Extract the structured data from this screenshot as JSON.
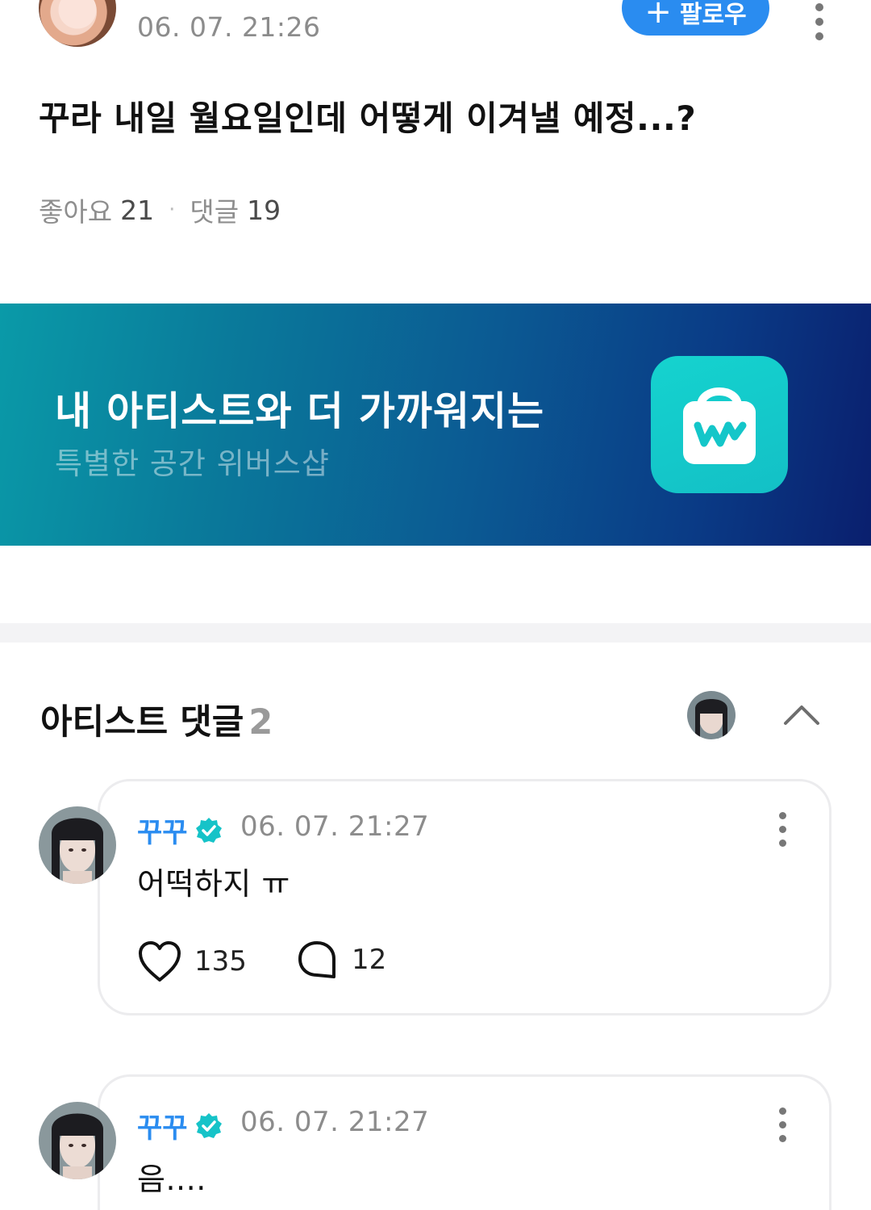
{
  "post": {
    "time": "06. 07. 21:26",
    "follow_label": "팔로우",
    "follow_plus": "+",
    "body": "꾸라 내일 월요일인데 어떻게 이겨낼 예정...?",
    "likes_label": "좋아요",
    "likes_count": "21",
    "comments_label": "댓글",
    "comments_count": "19",
    "separator": "·"
  },
  "banner": {
    "title": "내 아티스트와 더 가까워지는",
    "subtitle": "특별한 공간 위버스샵",
    "icon": "weverse-shop-bag-icon"
  },
  "artist_comments": {
    "title": "아티스트 댓글",
    "count": "2",
    "items": [
      {
        "name": "꾸꾸",
        "time": "06. 07. 21:27",
        "text": "어떡하지 ㅠ",
        "likes": "135",
        "replies": "12"
      },
      {
        "name": "꾸꾸",
        "time": "06. 07. 21:27",
        "text": "음...."
      }
    ]
  },
  "colors": {
    "accent": "#2a8cf0",
    "verified": "#16c3c8",
    "banner_start": "#0a9aa8",
    "banner_end": "#0a1f6e"
  }
}
